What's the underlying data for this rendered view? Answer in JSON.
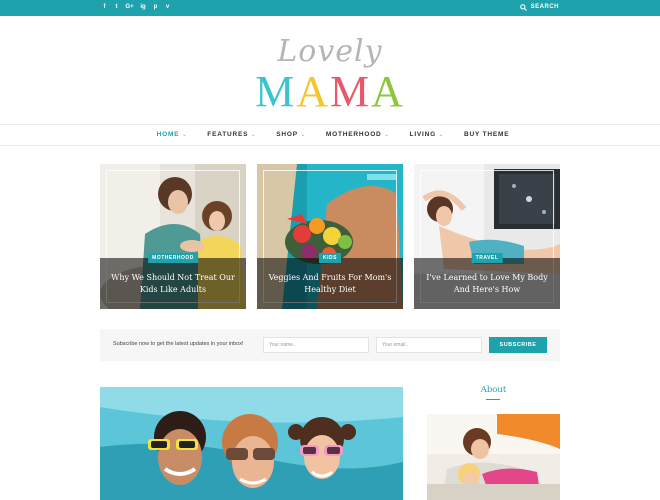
{
  "topbar": {
    "social": [
      "f",
      "t",
      "G+",
      "ig",
      "p",
      "v"
    ],
    "search_label": "SEARCH",
    "color": "#1ea3ad"
  },
  "logo": {
    "script": "Lovely",
    "main": [
      "M",
      "A",
      "M",
      "A"
    ]
  },
  "nav": {
    "items": [
      {
        "label": "HOME",
        "caret": "⌄"
      },
      {
        "label": "FEATURES",
        "caret": "⌄"
      },
      {
        "label": "SHOP",
        "caret": "⌄"
      },
      {
        "label": "MOTHERHOOD",
        "caret": "⌄"
      },
      {
        "label": "LIVING",
        "caret": "⌄"
      },
      {
        "label": "BUY THEME",
        "caret": ""
      }
    ]
  },
  "featured": [
    {
      "tag": "MOTHERHOOD",
      "title": "Why We Should Not Treat Our Kids Like Adults"
    },
    {
      "tag": "KIDS",
      "title": "Veggies And Fruits For Mom's Healthy Diet"
    },
    {
      "tag": "TRAVEL",
      "title": "I've Learned to Love My Body And Here's How"
    }
  ],
  "subscribe": {
    "text": "Subscribe now to get the latest updates in your inbox!",
    "name_placeholder": "Your name..",
    "email_placeholder": "Your email..",
    "button": "SUBSCRIBE"
  },
  "sidebar": {
    "about_title": "About"
  }
}
